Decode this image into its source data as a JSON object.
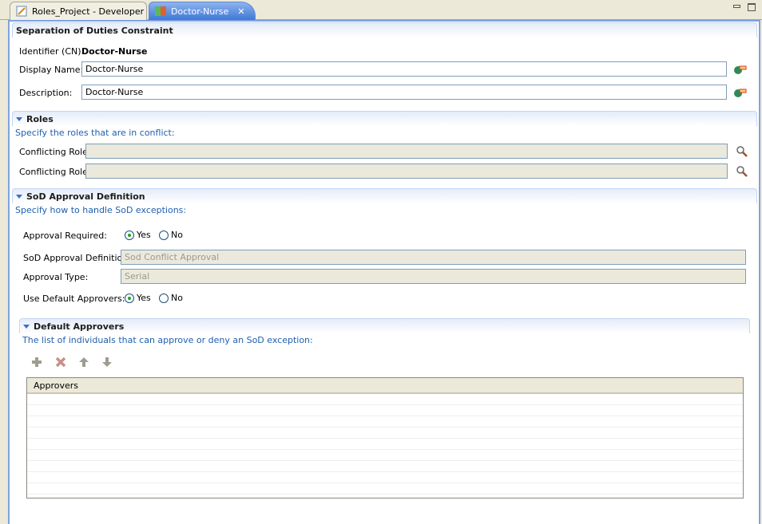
{
  "tabs": [
    {
      "label": "Roles_Project - Developer",
      "icon": "project-icon"
    },
    {
      "label": "Doctor-Nurse",
      "icon": "sod-icon",
      "close": "✕"
    }
  ],
  "main": {
    "title": "Separation of Duties Constraint",
    "identifier_label": "Identifier (CN):",
    "identifier_value": "Doctor-Nurse",
    "display_name_label": "Display Name:",
    "display_name_value": "Doctor-Nurse",
    "description_label": "Description:",
    "description_value": "Doctor-Nurse"
  },
  "roles": {
    "title": "Roles",
    "subtitle": "Specify the roles that are in conflict:",
    "conflicting_role_label": "Conflicting Role:",
    "role1": "",
    "role2": ""
  },
  "sod": {
    "title": "SoD Approval Definition",
    "subtitle": "Specify how to handle SoD exceptions:",
    "approval_required_label": "Approval Required:",
    "yes": "Yes",
    "no": "No",
    "approval_required": "Yes",
    "definition_label": "SoD Approval Definition:",
    "definition_value": "Sod Conflict Approval",
    "type_label": "Approval Type:",
    "type_value": "Serial",
    "use_default_label": "Use Default Approvers:",
    "use_default": "Yes"
  },
  "approvers": {
    "title": "Default Approvers",
    "subtitle": "The list of individuals that can approve or deny an SoD exception:",
    "column": "Approvers",
    "rows": []
  },
  "colors": {
    "accent": "#1f5fb0",
    "border": "#7fa3e0"
  }
}
